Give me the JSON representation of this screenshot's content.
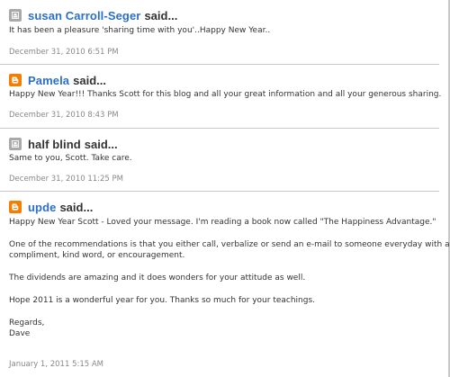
{
  "comments": [
    {
      "author": "susan Carroll-Seger",
      "said": "said...",
      "avatar_icon": "default-profile-icon",
      "author_is_link": true,
      "body": [
        "It has been a pleasure 'sharing time with you'..Happy New Year.."
      ],
      "timestamp": "December 31, 2010 6:51 PM"
    },
    {
      "author": "Pamela",
      "said": "said...",
      "avatar_icon": "blogger-icon",
      "author_is_link": true,
      "body": [
        "Happy New Year!!! Thanks Scott for this blog and all your great information and all your generous sharing."
      ],
      "timestamp": "December 31, 2010 8:43 PM"
    },
    {
      "author": "half blind",
      "said": "said...",
      "avatar_icon": "default-profile-icon",
      "author_is_link": false,
      "body": [
        "Same to you, Scott. Take care."
      ],
      "timestamp": "December 31, 2010 11:25 PM"
    },
    {
      "author": "upde",
      "said": "said...",
      "avatar_icon": "blogger-icon",
      "author_is_link": true,
      "body": [
        "Happy New Year Scott - Loved your message. I'm reading a book now called \"The Happiness Advantage.\"",
        "One of the recommendations is that you either call, verbalize or send an e-mail to someone everyday with a",
        "compliment, kind word, or encouragement.",
        "The dividends are amazing and it does wonders for your attitude as well.",
        "Hope 2011 is a wonderful year for you. Thanks so much for your teachings.",
        "Regards,",
        "Dave"
      ],
      "timestamp": "January 1, 2011 5:15 AM"
    }
  ],
  "colors": {
    "link": "#2b6fcb",
    "text": "#333333",
    "timestamp": "#888888",
    "divider": "#c8c8c8",
    "blogger_orange": "#f57d00",
    "default_avatar": "#a9a9a9"
  }
}
